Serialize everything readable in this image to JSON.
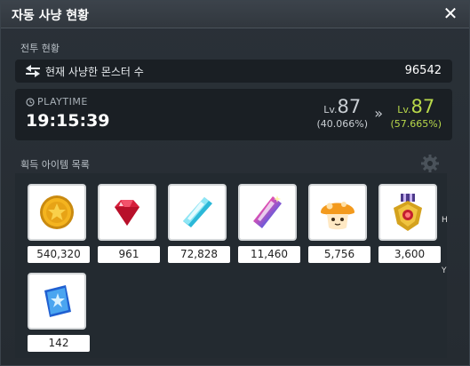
{
  "window": {
    "title": "자동 사냥 현황"
  },
  "battle": {
    "section_label": "전투 현황",
    "monster_label": "현재 사냥한 몬스터 수",
    "monster_count": "96542"
  },
  "playtime": {
    "label": "PLAYTIME",
    "time": "19:15:39",
    "level_prefix": "Lv.",
    "old_level": "87",
    "old_percent": "(40.066%)",
    "arrow": "»",
    "new_level": "87",
    "new_percent": "(57.665%)"
  },
  "items": {
    "section_label": "획득 아이템 목록",
    "list": [
      {
        "icon": "gold-coin-icon",
        "count": "540,320"
      },
      {
        "icon": "red-gem-icon",
        "count": "961"
      },
      {
        "icon": "cyan-crystal-icon",
        "count": "72,828"
      },
      {
        "icon": "rainbow-crystal-icon",
        "count": "11,460"
      },
      {
        "icon": "orange-mushroom-icon",
        "count": "5,756"
      },
      {
        "icon": "medal-icon",
        "count": "3,600"
      },
      {
        "icon": "blue-ticket-icon",
        "count": "142"
      }
    ]
  },
  "side_letters": [
    "H",
    "Y"
  ],
  "colors": {
    "panel": "#252b31",
    "new_level": "#b8d84a",
    "old_level": "#c9ced3"
  }
}
